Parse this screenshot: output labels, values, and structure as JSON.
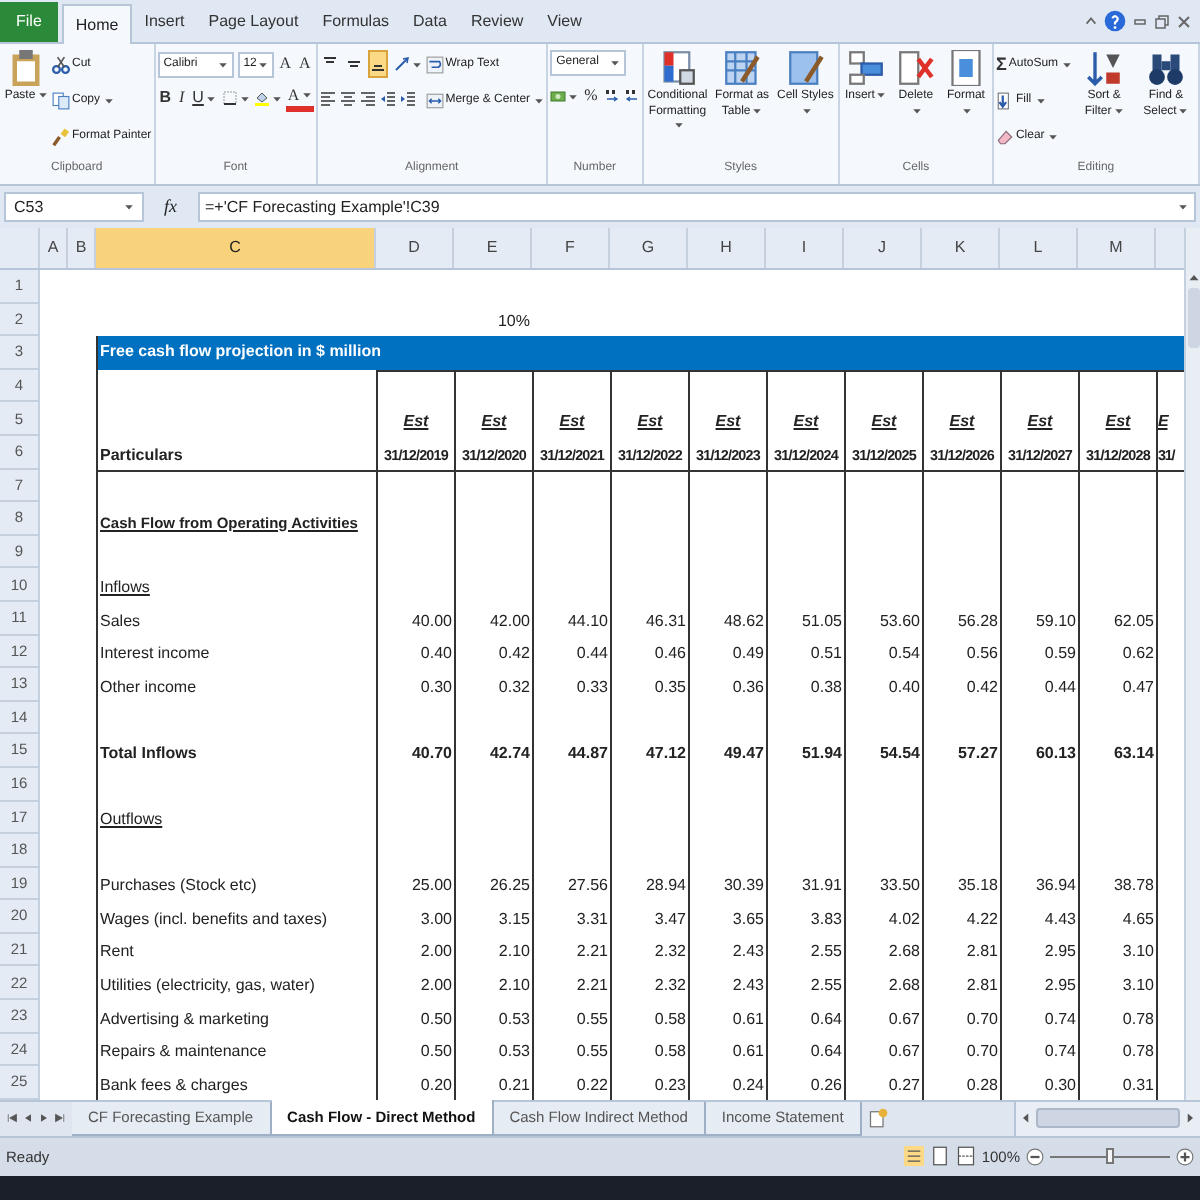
{
  "menu_tabs": [
    {
      "label": "File",
      "kind": "file",
      "selected": false
    },
    {
      "label": "Home",
      "kind": "tab",
      "selected": true
    },
    {
      "label": "Insert",
      "kind": "tab",
      "selected": false
    },
    {
      "label": "Page Layout",
      "kind": "tab",
      "selected": false
    },
    {
      "label": "Formulas",
      "kind": "tab",
      "selected": false
    },
    {
      "label": "Data",
      "kind": "tab",
      "selected": false
    },
    {
      "label": "Review",
      "kind": "tab",
      "selected": false
    },
    {
      "label": "View",
      "kind": "tab",
      "selected": false
    }
  ],
  "ribbon": [
    {
      "label": "Clipboard",
      "columns": [
        [
          [
            {
              "kind": "large",
              "label": "Paste",
              "dropdown": true
            }
          ]
        ],
        [
          [
            {
              "kind": "small",
              "label": "Cut"
            }
          ],
          [
            {
              "kind": "small",
              "label": "Copy",
              "dropdown": true
            }
          ],
          [
            {
              "kind": "small",
              "label": "Format Painter"
            }
          ]
        ]
      ]
    },
    {
      "label": "Font",
      "columns": [
        [
          [
            {
              "kind": "select",
              "value": "Calibri"
            },
            {
              "kind": "select",
              "value": "12"
            },
            {
              "kind": "glyph",
              "label": "A"
            },
            {
              "kind": "glyph",
              "label": "A"
            }
          ],
          [
            {
              "kind": "bold",
              "label": "B"
            },
            {
              "kind": "italic",
              "label": "I"
            },
            {
              "kind": "underline",
              "label": "U",
              "dropdown": true
            },
            {
              "kind": "icon",
              "dropdown": true
            },
            {
              "kind": "icon",
              "dropdown": true
            },
            {
              "kind": "font_color",
              "label": "A",
              "dropdown": true
            }
          ]
        ]
      ]
    },
    {
      "label": "Alignment",
      "columns": [
        [
          [
            {
              "kind": "icon",
              "selected": false
            },
            {
              "kind": "icon",
              "selected": false
            },
            {
              "kind": "icon",
              "selected": true
            },
            {
              "kind": "icon",
              "dropdown": true,
              "selected": false
            }
          ],
          [
            {
              "kind": "icon"
            },
            {
              "kind": "icon"
            },
            {
              "kind": "icon"
            },
            {
              "kind": "icon"
            },
            {
              "kind": "icon"
            }
          ]
        ],
        [
          [
            {
              "kind": "small",
              "label": "Wrap Text"
            }
          ],
          [
            {
              "kind": "small",
              "label": "Merge & Center",
              "dropdown": true
            }
          ]
        ]
      ]
    },
    {
      "label": "Number",
      "columns": [
        [
          [
            {
              "kind": "select",
              "value": "General"
            }
          ],
          [
            {
              "kind": "icon",
              "dropdown": true
            },
            {
              "kind": "glyph",
              "label": "%"
            },
            {
              "kind": "icon"
            },
            {
              "kind": "icon"
            }
          ]
        ]
      ]
    },
    {
      "label": "Styles",
      "columns": [
        [
          [
            {
              "kind": "large",
              "label": "Conditional Formatting",
              "dropdown": true
            }
          ]
        ],
        [
          [
            {
              "kind": "large",
              "label": "Format as Table",
              "dropdown": true
            }
          ]
        ],
        [
          [
            {
              "kind": "large",
              "label": "Cell Styles",
              "dropdown": true
            }
          ]
        ]
      ]
    },
    {
      "label": "Cells",
      "columns": [
        [
          [
            {
              "kind": "large",
              "label": "Insert",
              "dropdown": true
            }
          ]
        ],
        [
          [
            {
              "kind": "large",
              "label": "Delete",
              "dropdown": true
            }
          ]
        ],
        [
          [
            {
              "kind": "large",
              "label": "Format",
              "dropdown": true
            }
          ]
        ]
      ]
    },
    {
      "label": "Editing",
      "columns": [
        [
          [
            {
              "kind": "symbol",
              "symbol": "Σ",
              "label": "AutoSum",
              "dropdown": true
            }
          ],
          [
            {
              "kind": "small",
              "label": "Fill",
              "dropdown": true
            }
          ],
          [
            {
              "kind": "small",
              "label": "Clear",
              "dropdown": true
            }
          ]
        ],
        [
          [
            {
              "kind": "large",
              "label": "Sort & Filter",
              "dropdown": true
            }
          ]
        ],
        [
          [
            {
              "kind": "large",
              "label": "Find & Select",
              "dropdown": true
            }
          ]
        ]
      ]
    }
  ],
  "formula_bar": {
    "name_box": "C53",
    "fx": "fx",
    "formula": "=+'CF Forecasting Example'!C39"
  },
  "columns": [
    {
      "letter": "A",
      "selected": false
    },
    {
      "letter": "B",
      "selected": false
    },
    {
      "letter": "C",
      "selected": true
    },
    {
      "letter": "D",
      "selected": false
    },
    {
      "letter": "E",
      "selected": false
    },
    {
      "letter": "F",
      "selected": false
    },
    {
      "letter": "G",
      "selected": false
    },
    {
      "letter": "H",
      "selected": false
    },
    {
      "letter": "I",
      "selected": false
    },
    {
      "letter": "J",
      "selected": false
    },
    {
      "letter": "K",
      "selected": false
    },
    {
      "letter": "L",
      "selected": false
    },
    {
      "letter": "M",
      "selected": false
    }
  ],
  "rows": [
    {
      "num": "1",
      "kind": "blank"
    },
    {
      "num": "2",
      "kind": "percent",
      "value": "10%"
    },
    {
      "num": "3",
      "kind": "band",
      "label": "Free cash flow projection in $ million"
    },
    {
      "num": "4",
      "kind": "blank"
    },
    {
      "num": "5",
      "kind": "header_top",
      "values": [
        "Est",
        "Est",
        "Est",
        "Est",
        "Est",
        "Est",
        "Est",
        "Est",
        "Est",
        "Est",
        "E"
      ]
    },
    {
      "num": "6",
      "kind": "header_date",
      "label": "Particulars",
      "values": [
        "31/12/2019",
        "31/12/2020",
        "31/12/2021",
        "31/12/2022",
        "31/12/2023",
        "31/12/2024",
        "31/12/2025",
        "31/12/2026",
        "31/12/2027",
        "31/12/2028",
        "31/"
      ]
    },
    {
      "num": "7",
      "kind": "blank"
    },
    {
      "num": "8",
      "kind": "section",
      "label": "Cash Flow from Operating Activities"
    },
    {
      "num": "9",
      "kind": "blank"
    },
    {
      "num": "10",
      "kind": "subheader",
      "label": "Inflows"
    },
    {
      "num": "11",
      "kind": "item",
      "label": "Sales",
      "values": [
        "40.00",
        "42.00",
        "44.10",
        "46.31",
        "48.62",
        "51.05",
        "53.60",
        "56.28",
        "59.10",
        "62.05"
      ]
    },
    {
      "num": "12",
      "kind": "item",
      "label": "Interest income",
      "values": [
        "0.40",
        "0.42",
        "0.44",
        "0.46",
        "0.49",
        "0.51",
        "0.54",
        "0.56",
        "0.59",
        "0.62"
      ]
    },
    {
      "num": "13",
      "kind": "item",
      "label": "Other income",
      "values": [
        "0.30",
        "0.32",
        "0.33",
        "0.35",
        "0.36",
        "0.38",
        "0.40",
        "0.42",
        "0.44",
        "0.47"
      ]
    },
    {
      "num": "14",
      "kind": "blank"
    },
    {
      "num": "15",
      "kind": "total",
      "label": "Total Inflows",
      "values": [
        "40.70",
        "42.74",
        "44.87",
        "47.12",
        "49.47",
        "51.94",
        "54.54",
        "57.27",
        "60.13",
        "63.14"
      ]
    },
    {
      "num": "16",
      "kind": "blank"
    },
    {
      "num": "17",
      "kind": "subheader",
      "label": "Outflows"
    },
    {
      "num": "18",
      "kind": "blank"
    },
    {
      "num": "19",
      "kind": "item",
      "label": "Purchases (Stock etc)",
      "values": [
        "25.00",
        "26.25",
        "27.56",
        "28.94",
        "30.39",
        "31.91",
        "33.50",
        "35.18",
        "36.94",
        "38.78"
      ]
    },
    {
      "num": "20",
      "kind": "item",
      "label": "Wages (incl. benefits and taxes)",
      "values": [
        "3.00",
        "3.15",
        "3.31",
        "3.47",
        "3.65",
        "3.83",
        "4.02",
        "4.22",
        "4.43",
        "4.65"
      ]
    },
    {
      "num": "21",
      "kind": "item",
      "label": "Rent",
      "values": [
        "2.00",
        "2.10",
        "2.21",
        "2.32",
        "2.43",
        "2.55",
        "2.68",
        "2.81",
        "2.95",
        "3.10"
      ]
    },
    {
      "num": "22",
      "kind": "item",
      "label": "Utilities (electricity, gas, water)",
      "values": [
        "2.00",
        "2.10",
        "2.21",
        "2.32",
        "2.43",
        "2.55",
        "2.68",
        "2.81",
        "2.95",
        "3.10"
      ]
    },
    {
      "num": "23",
      "kind": "item",
      "label": "Advertising & marketing",
      "values": [
        "0.50",
        "0.53",
        "0.55",
        "0.58",
        "0.61",
        "0.64",
        "0.67",
        "0.70",
        "0.74",
        "0.78"
      ]
    },
    {
      "num": "24",
      "kind": "item",
      "label": "Repairs & maintenance",
      "values": [
        "0.50",
        "0.53",
        "0.55",
        "0.58",
        "0.61",
        "0.64",
        "0.67",
        "0.70",
        "0.74",
        "0.78"
      ]
    },
    {
      "num": "25",
      "kind": "item",
      "label": "Bank fees & charges",
      "values": [
        "0.20",
        "0.21",
        "0.22",
        "0.23",
        "0.24",
        "0.26",
        "0.27",
        "0.28",
        "0.30",
        "0.31"
      ]
    }
  ],
  "sheet_tabs": [
    {
      "label": "CF Forecasting Example",
      "selected": false
    },
    {
      "label": "Cash Flow - Direct Method",
      "selected": true
    },
    {
      "label": "Cash Flow Indirect Method",
      "selected": false
    },
    {
      "label": "Income Statement",
      "selected": false
    }
  ],
  "status_bar": {
    "status": "Ready",
    "zoom": {
      "label": "100%",
      "level": 0.5
    }
  }
}
